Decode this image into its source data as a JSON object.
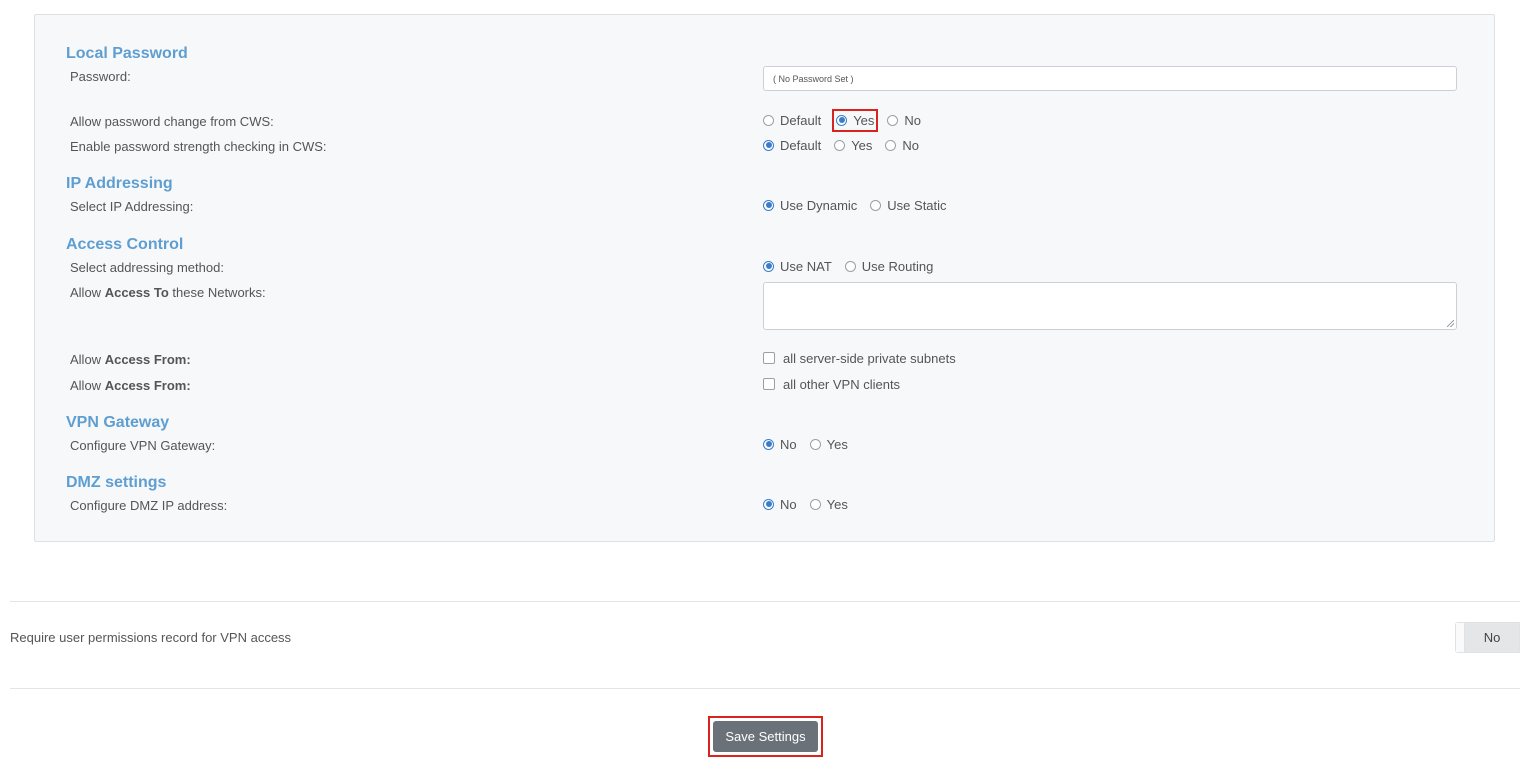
{
  "local_password": {
    "title": "Local Password",
    "password_label": "Password:",
    "password_value": "( No Password Set )",
    "allow_change_label": "Allow password change from CWS:",
    "allow_change_options": [
      "Default",
      "Yes",
      "No"
    ],
    "allow_change_selected": "Yes",
    "strength_label": "Enable password strength checking in CWS:",
    "strength_options": [
      "Default",
      "Yes",
      "No"
    ],
    "strength_selected": "Default"
  },
  "ip_addressing": {
    "title": "IP Addressing",
    "select_label": "Select IP Addressing:",
    "options": [
      "Use Dynamic",
      "Use Static"
    ],
    "selected": "Use Dynamic"
  },
  "access_control": {
    "title": "Access Control",
    "method_label": "Select addressing method:",
    "method_options": [
      "Use NAT",
      "Use Routing"
    ],
    "method_selected": "Use NAT",
    "access_to_prefix": "Allow",
    "access_to_bold": "Access To",
    "access_to_suffix": "these Networks:",
    "networks_value": "",
    "access_from_prefix": "Allow",
    "access_from_bold": "Access From:",
    "access_from_1_option": "all server-side private subnets",
    "access_from_2_option": "all other VPN clients"
  },
  "vpn_gateway": {
    "title": "VPN Gateway",
    "configure_label": "Configure VPN Gateway:",
    "options": [
      "No",
      "Yes"
    ],
    "selected": "No"
  },
  "dmz": {
    "title": "DMZ settings",
    "configure_label": "Configure DMZ IP address:",
    "options": [
      "No",
      "Yes"
    ],
    "selected": "No"
  },
  "permissions": {
    "label": "Require user permissions record for VPN access",
    "toggle_value": "No"
  },
  "save_button": "Save Settings",
  "colors": {
    "section_title": "#5f9ed1",
    "radio_checked": "#3b7dc9",
    "highlight": "#d9231e",
    "save_button_bg": "#6b7178"
  }
}
